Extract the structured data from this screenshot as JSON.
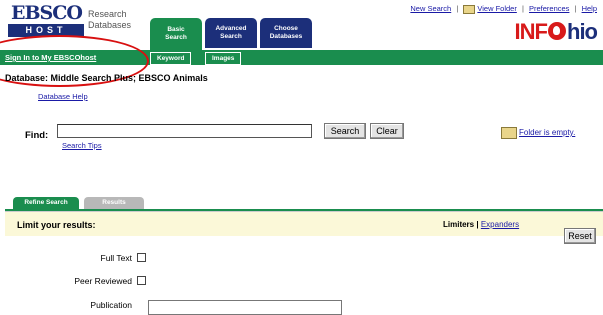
{
  "header": {
    "logo_top": "EBSCO",
    "logo_bottom": "HOST",
    "research_line1": "Research",
    "research_line2": "Databases",
    "tabs": [
      {
        "line1": "Basic",
        "line2": "Search"
      },
      {
        "line1": "Advanced",
        "line2": "Search"
      },
      {
        "line1": "Choose",
        "line2": "Databases"
      }
    ],
    "links": {
      "new_search": "New Search",
      "view_folder": "View Folder",
      "preferences": "Preferences",
      "help": "Help",
      "separator": "|"
    },
    "brand": {
      "left": "INF",
      "right": "hio"
    }
  },
  "greenbar": {
    "signin": "Sign In to My EBSCOhost",
    "subtabs": [
      "Keyword",
      "Images"
    ]
  },
  "database": {
    "label": "Database: Middle Search Plus; EBSCO Animals",
    "help": "Database Help"
  },
  "find": {
    "label": "Find:",
    "value": "",
    "search_button": "Search",
    "clear_button": "Clear",
    "search_tips": "Search Tips",
    "folder_status": "Folder is empty."
  },
  "lower_tabs": [
    "Refine Search",
    "Results"
  ],
  "limits": {
    "heading": "Limit your results:",
    "limiters": "Limiters",
    "separator": "|",
    "expanders": "Expanders",
    "reset": "Reset",
    "rows": [
      {
        "label": "Full Text",
        "checked": false
      },
      {
        "label": "Peer Reviewed",
        "checked": false
      },
      {
        "label": "Publication",
        "checked": false
      }
    ]
  },
  "colors": {
    "green": "#1a8d4e",
    "navy": "#1c2f7a",
    "red": "#d81a1a",
    "panel": "#fbf8d8"
  }
}
